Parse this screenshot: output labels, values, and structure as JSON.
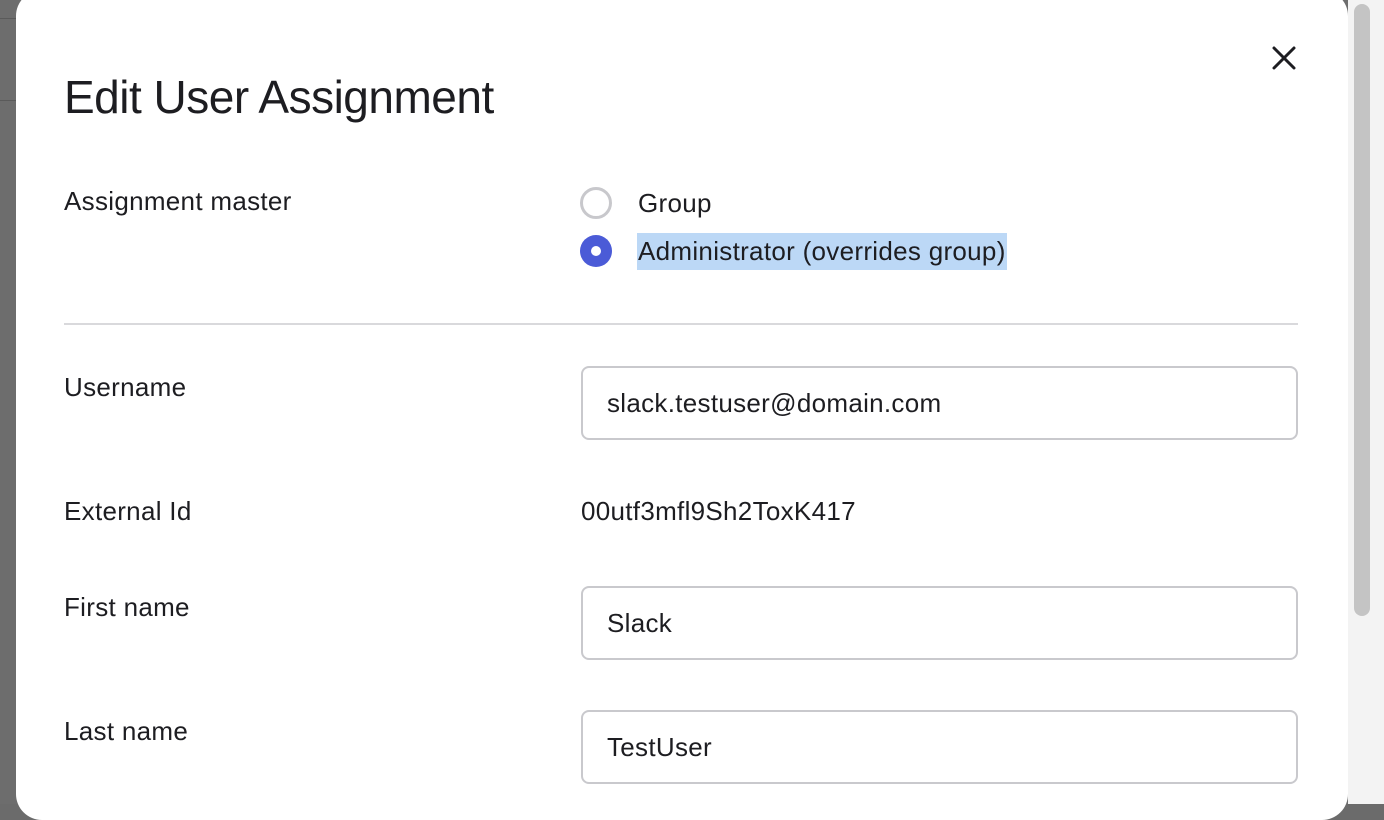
{
  "dialog": {
    "title": "Edit User Assignment",
    "close_icon": "close-icon"
  },
  "assignment_master": {
    "label": "Assignment master",
    "options": [
      {
        "label": "Group",
        "selected": false
      },
      {
        "label": "Administrator (overrides group)",
        "selected": true
      }
    ]
  },
  "fields": {
    "username": {
      "label": "Username",
      "value": "slack.testuser@domain.com"
    },
    "external_id": {
      "label": "External Id",
      "value": "00utf3mfl9Sh2ToxK417"
    },
    "first_name": {
      "label": "First name",
      "value": "Slack"
    },
    "last_name": {
      "label": "Last name",
      "value": "TestUser"
    }
  },
  "colors": {
    "accent": "#4b5bd7",
    "text_selection": "#bcd8f6",
    "backdrop": "#6d6d6d"
  }
}
